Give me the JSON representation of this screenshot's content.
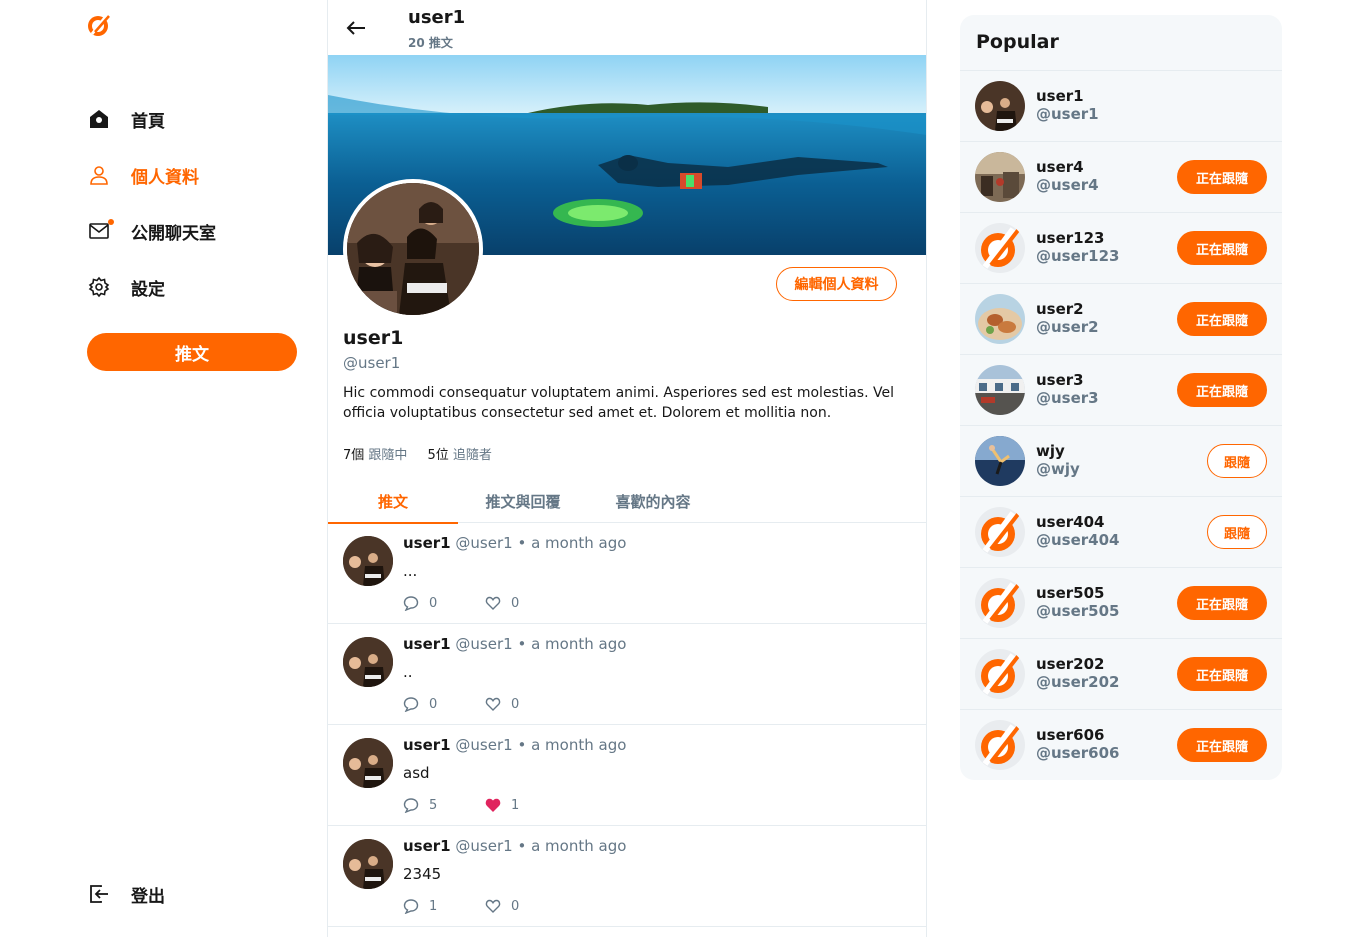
{
  "sidebar": {
    "logo": "alpha-logo",
    "nav": [
      {
        "label": "首頁",
        "icon": "home-icon",
        "active": false,
        "dot": false
      },
      {
        "label": "個人資料",
        "icon": "user-icon",
        "active": true,
        "dot": false
      },
      {
        "label": "公開聊天室",
        "icon": "mail-icon",
        "active": false,
        "dot": true
      },
      {
        "label": "設定",
        "icon": "gear-icon",
        "active": false,
        "dot": false
      }
    ],
    "tweet_button": "推文",
    "logout": "登出"
  },
  "header": {
    "name": "user1",
    "tweet_count": "20 推文"
  },
  "profile": {
    "edit_button": "編輯個人資料",
    "name": "user1",
    "handle": "@user1",
    "bio": "Hic commodi consequatur voluptatem animi. Asperiores sed est molestias. Vel officia voluptatibus consectetur sed amet et. Dolorem et mollitia non.",
    "following_count": "7個",
    "following_label": "跟隨中",
    "followers_count": "5位",
    "followers_label": "追隨者"
  },
  "tabs": [
    {
      "label": "推文",
      "active": true
    },
    {
      "label": "推文與回覆",
      "active": false
    },
    {
      "label": "喜歡的內容",
      "active": false
    }
  ],
  "tweets": [
    {
      "name": "user1",
      "handle": "@user1",
      "sep": "•",
      "time": "a month ago",
      "body": "...",
      "replies": "0",
      "likes": "0",
      "liked": false
    },
    {
      "name": "user1",
      "handle": "@user1",
      "sep": "•",
      "time": "a month ago",
      "body": "..",
      "replies": "0",
      "likes": "0",
      "liked": false
    },
    {
      "name": "user1",
      "handle": "@user1",
      "sep": "•",
      "time": "a month ago",
      "body": "asd",
      "replies": "5",
      "likes": "1",
      "liked": true
    },
    {
      "name": "user1",
      "handle": "@user1",
      "sep": "•",
      "time": "a month ago",
      "body": "2345",
      "replies": "1",
      "likes": "0",
      "liked": false
    }
  ],
  "popular": {
    "title": "Popular",
    "users": [
      {
        "name": "user1",
        "handle": "@user1",
        "button": "",
        "avatar": "photo-party"
      },
      {
        "name": "user4",
        "handle": "@user4",
        "button": "正在跟隨",
        "avatar": "photo-street"
      },
      {
        "name": "user123",
        "handle": "@user123",
        "button": "正在跟隨",
        "avatar": "logo"
      },
      {
        "name": "user2",
        "handle": "@user2",
        "button": "正在跟隨",
        "avatar": "photo-food"
      },
      {
        "name": "user3",
        "handle": "@user3",
        "button": "正在跟隨",
        "avatar": "photo-city"
      },
      {
        "name": "wjy",
        "handle": "@wjy",
        "button": "跟隨",
        "avatar": "photo-jump"
      },
      {
        "name": "user404",
        "handle": "@user404",
        "button": "跟隨",
        "avatar": "logo"
      },
      {
        "name": "user505",
        "handle": "@user505",
        "button": "正在跟隨",
        "avatar": "logo"
      },
      {
        "name": "user202",
        "handle": "@user202",
        "button": "正在跟隨",
        "avatar": "logo"
      },
      {
        "name": "user606",
        "handle": "@user606",
        "button": "正在跟隨",
        "avatar": "logo"
      }
    ]
  },
  "colors": {
    "accent": "#ff6600",
    "muted": "#657786",
    "like": "#e0245e",
    "panel": "#f5f8fa"
  }
}
